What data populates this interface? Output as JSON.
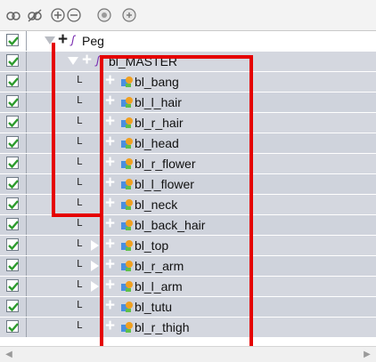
{
  "toolbar": {
    "icons": [
      "view-all-icon",
      "hide-icon",
      "expand-collapse-icon",
      "enable-icon",
      "add-icon"
    ]
  },
  "tree": {
    "root": {
      "label": "Peg"
    },
    "master": {
      "label": "bl_MASTER"
    },
    "children": [
      {
        "label": "bl_bang"
      },
      {
        "label": "bl_l_hair"
      },
      {
        "label": "bl_r_hair"
      },
      {
        "label": "bl_head"
      },
      {
        "label": "bl_r_flower"
      },
      {
        "label": "bl_l_flower"
      },
      {
        "label": "bl_neck"
      },
      {
        "label": "bl_back_hair"
      },
      {
        "label": "bl_top"
      },
      {
        "label": "bl_r_arm"
      },
      {
        "label": "bl_l_arm"
      },
      {
        "label": "bl_tutu"
      },
      {
        "label": "bl_r_thigh"
      }
    ]
  },
  "colors": {
    "highlight": "#e50000",
    "checkbox_check": "#2c9b2c",
    "row_selected": "#d4d7df"
  }
}
